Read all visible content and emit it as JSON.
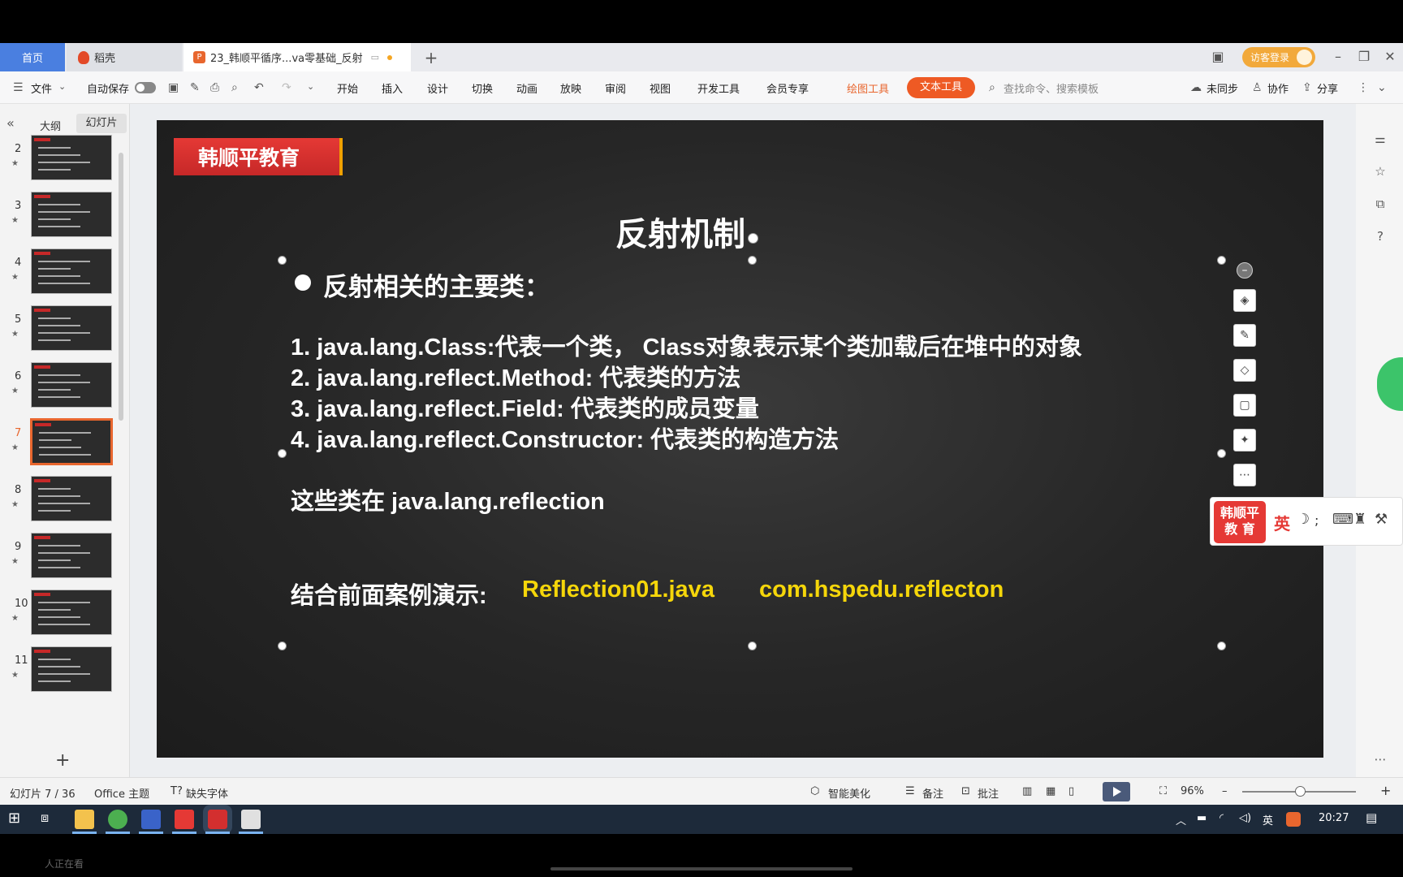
{
  "tabs": {
    "home": "首页",
    "daoke": "稻壳",
    "document": "23_韩顺平循序...va零基础_反射"
  },
  "login_label": "访客登录",
  "menu": {
    "file": "文件",
    "autosave": "自动保存",
    "items": [
      "开始",
      "插入",
      "设计",
      "切换",
      "动画",
      "放映",
      "审阅",
      "视图",
      "开发工具",
      "会员专享"
    ],
    "draw_tools": "绘图工具",
    "text_tools": "文本工具",
    "search_placeholder": "查找命令、搜索模板",
    "sync": "未同步",
    "collab": "协作",
    "share": "分享"
  },
  "left_panel": {
    "tab_outline": "大纲",
    "tab_slides": "幻灯片",
    "slides": [
      {
        "num": "2",
        "selected": false
      },
      {
        "num": "3",
        "selected": false
      },
      {
        "num": "4",
        "selected": false
      },
      {
        "num": "5",
        "selected": false
      },
      {
        "num": "6",
        "selected": false
      },
      {
        "num": "7",
        "selected": true
      },
      {
        "num": "8",
        "selected": false
      },
      {
        "num": "9",
        "selected": false
      },
      {
        "num": "10",
        "selected": false
      },
      {
        "num": "11",
        "selected": false
      }
    ]
  },
  "slide": {
    "logo": "韩顺平教育",
    "title": "反射机制",
    "bullet": "反射相关的主要类：",
    "items": [
      "1. java.lang.Class:代表一个类， Class对象表示某个类加载后在堆中的对象",
      "2. java.lang.reflect.Method: 代表类的方法",
      "3. java.lang.reflect.Field: 代表类的成员变量",
      "4. java.lang.reflect.Constructor: 代表类的构造方法"
    ],
    "note": "这些类在 java.lang.reflection",
    "demo_label": "结合前面案例演示:",
    "demo_file": "Reflection01.java",
    "demo_package": "com.hspedu.reflecton"
  },
  "ime": {
    "logo_line1": "韩顺平",
    "logo_line2": "教 育",
    "lang": "英"
  },
  "status": {
    "slide_counter": "幻灯片 7 / 36",
    "theme": "Office 主题",
    "missing_font": "缺失字体",
    "beautify": "智能美化",
    "notes": "备注",
    "comment": "批注",
    "zoom": "96%"
  },
  "taskbar": {
    "ime_lang": "英",
    "clock": "20:27"
  },
  "viewer_overlay": "人正在看",
  "colors": {
    "accent_orange": "#ee5a24",
    "slide_yellow": "#f5d60a",
    "logo_red": "#e53935"
  }
}
